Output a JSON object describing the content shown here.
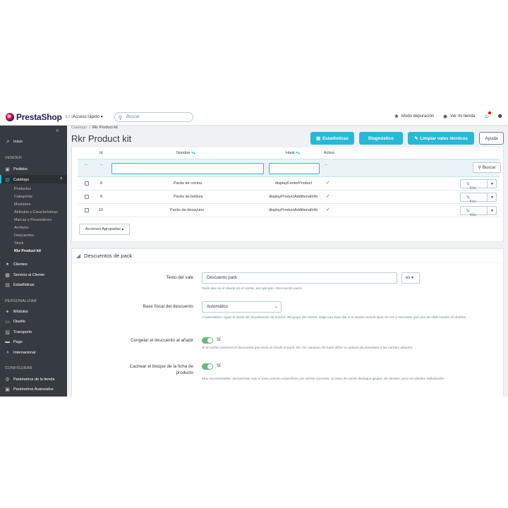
{
  "header": {
    "brand": "PrestaShop",
    "version": "8.2.0",
    "quick_access": "Acceso rápido ▾",
    "search_placeholder": "Buscar",
    "debug_mode": "Modo depuración",
    "view_store": "Ver mi tienda"
  },
  "sidebar": {
    "home": "Inicio",
    "sections": [
      "VENDER",
      "PERSONALIZAR",
      "CONFIGURAR"
    ],
    "sell_items": [
      "Pedidos",
      "Catálogo"
    ],
    "catalog_sub": [
      "Productos",
      "Categorías",
      "Monitoreo",
      "Atributos y Características",
      "Marcas y Proveedores",
      "Archivos",
      "Descuentos",
      "Stock",
      "Rkr Product kit"
    ],
    "more_sell": [
      "Clientes",
      "Servicio al Cliente",
      "Estadísticas"
    ],
    "customize_items": [
      "Módulos",
      "Diseño",
      "Transporte",
      "Pago",
      "Internacional"
    ],
    "config_items": [
      "Parámetros de la tienda",
      "Parámetros Avanzados"
    ]
  },
  "page": {
    "breadcrumb_parent": "Catálogo",
    "breadcrumb_current": "Rkr Product kit",
    "title": "Rkr Product kit",
    "btn_stats": "Estadísticas",
    "btn_diag": "Diagnóstico",
    "btn_clean": "Limpiar vales técnicos",
    "btn_help": "Ayuda"
  },
  "table": {
    "columns": [
      "Id",
      "Nombre",
      "Hook",
      "Activo"
    ],
    "search_btn": "Buscar",
    "dash": "--",
    "rows": [
      {
        "id": "8",
        "name": "Packs de cocina",
        "hook": "displayFooterProduct",
        "action": "Kits"
      },
      {
        "id": "9",
        "name": "Packs de belleza",
        "hook": "displayProductAdditionalInfo",
        "action": "Kits"
      },
      {
        "id": "10",
        "name": "Packs de desayuno",
        "hook": "displayProductAdditionalInfo",
        "action": "Kits"
      }
    ],
    "bulk_actions": "Acciones Agrupadas ▴"
  },
  "form": {
    "title": "Descuentos de pack",
    "voucher_label": "Texto del vale",
    "voucher_value": "Descuento pack",
    "lang": "es",
    "voucher_help": "Texto que ve el cliente en el carrito, por ejemplo «Descuento pack»",
    "tax_label": "Base fiscal del descuento",
    "tax_value": "Automático",
    "tax_help": "«Automático» sigue el modo de visualización de precios del grupo del cliente. Elige una base fija si tu tienda mezcla tipos de IVA y necesitas que una de ellas cuadre al céntimo.",
    "freeze_label": "Congelar el descuento al añadir",
    "freeze_value": "SÍ",
    "freeze_help": "Si el carrito conserva el descuento que tenía al añadir el pack. No, los cambios del back office se aplican de inmediato a los carritos abiertos.",
    "cache_label_1": "Cachear el bloque de la ficha de",
    "cache_label_2": "producto",
    "cache_value": "SÍ",
    "cache_help": "Muy recomendable. Desactívalo solo si usas precios específicos por cliente concreto, la clave de caché distingue grupos de clientes, pero no clientes individuales."
  }
}
